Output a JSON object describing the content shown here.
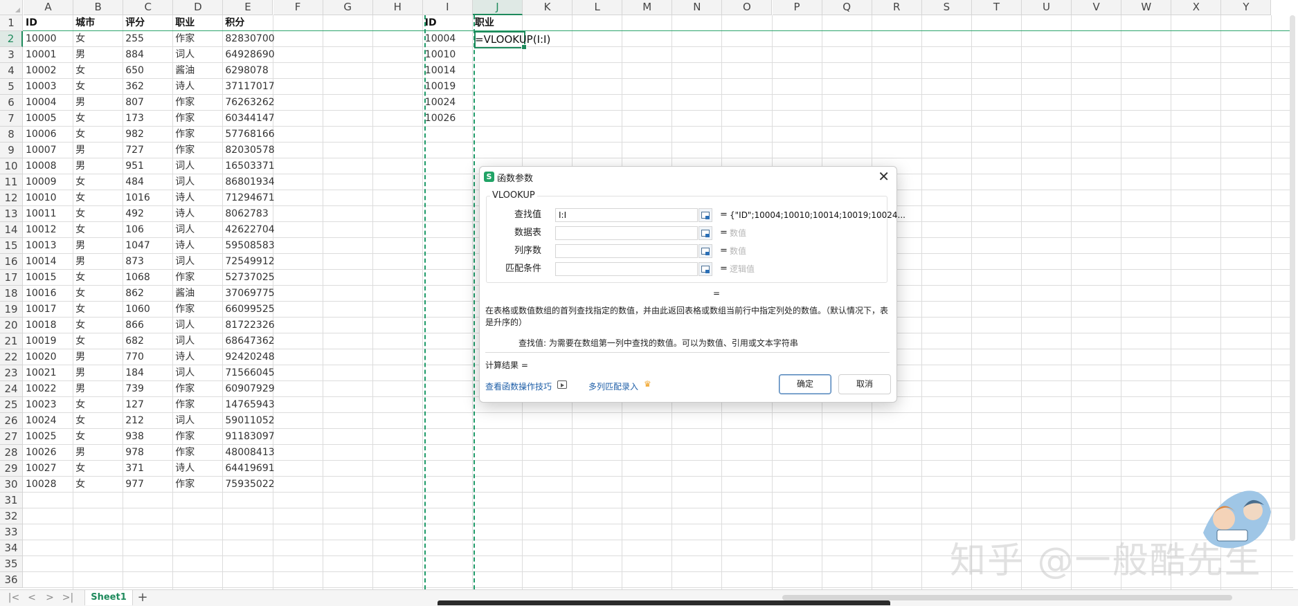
{
  "sheet": {
    "columns": [
      "A",
      "B",
      "C",
      "D",
      "E",
      "F",
      "G",
      "H",
      "I",
      "J",
      "K",
      "L",
      "M",
      "N",
      "O",
      "P",
      "Q",
      "R",
      "S",
      "T",
      "U",
      "V",
      "W",
      "X",
      "Y"
    ],
    "rows": [
      "1",
      "2",
      "3",
      "4",
      "5",
      "6",
      "7",
      "8",
      "9",
      "10",
      "11",
      "12",
      "13",
      "14",
      "15",
      "16",
      "17",
      "18",
      "19",
      "20",
      "21",
      "22",
      "23",
      "24",
      "25",
      "26",
      "27",
      "28",
      "29",
      "30",
      "31",
      "32",
      "33",
      "34",
      "35",
      "36"
    ],
    "active_col": "J",
    "active_row": "2",
    "headers": {
      "A": "ID",
      "B": "城市",
      "C": "评分",
      "D": "职业",
      "E": "积分",
      "I": "ID",
      "J": "职业"
    },
    "table": [
      [
        "10000",
        "女",
        "255",
        "作家",
        "82830700"
      ],
      [
        "10001",
        "男",
        "884",
        "词人",
        "64928690"
      ],
      [
        "10002",
        "女",
        "650",
        "酱油",
        "6298078"
      ],
      [
        "10003",
        "女",
        "362",
        "诗人",
        "37117017"
      ],
      [
        "10004",
        "男",
        "807",
        "作家",
        "76263262"
      ],
      [
        "10005",
        "女",
        "173",
        "作家",
        "60344147"
      ],
      [
        "10006",
        "女",
        "982",
        "作家",
        "57768166"
      ],
      [
        "10007",
        "男",
        "727",
        "作家",
        "82030578"
      ],
      [
        "10008",
        "男",
        "951",
        "词人",
        "16503371"
      ],
      [
        "10009",
        "女",
        "484",
        "词人",
        "86801934"
      ],
      [
        "10010",
        "女",
        "1016",
        "诗人",
        "71294671"
      ],
      [
        "10011",
        "女",
        "492",
        "诗人",
        "8062783"
      ],
      [
        "10012",
        "女",
        "106",
        "词人",
        "42622704"
      ],
      [
        "10013",
        "男",
        "1047",
        "诗人",
        "59508583"
      ],
      [
        "10014",
        "男",
        "873",
        "词人",
        "72549912"
      ],
      [
        "10015",
        "女",
        "1068",
        "作家",
        "52737025"
      ],
      [
        "10016",
        "女",
        "862",
        "酱油",
        "37069775"
      ],
      [
        "10017",
        "女",
        "1060",
        "作家",
        "66099525"
      ],
      [
        "10018",
        "女",
        "866",
        "词人",
        "81722326"
      ],
      [
        "10019",
        "女",
        "682",
        "词人",
        "68647362"
      ],
      [
        "10020",
        "男",
        "770",
        "诗人",
        "92420248"
      ],
      [
        "10021",
        "男",
        "184",
        "词人",
        "71566045"
      ],
      [
        "10022",
        "男",
        "739",
        "作家",
        "60907929"
      ],
      [
        "10023",
        "女",
        "127",
        "作家",
        "14765943"
      ],
      [
        "10024",
        "女",
        "212",
        "词人",
        "59011052"
      ],
      [
        "10025",
        "女",
        "938",
        "作家",
        "91183097"
      ],
      [
        "10026",
        "男",
        "978",
        "作家",
        "48008413"
      ],
      [
        "10027",
        "女",
        "371",
        "诗人",
        "64419691"
      ],
      [
        "10028",
        "女",
        "977",
        "作家",
        "75935022"
      ]
    ],
    "lookup_ids": [
      "10004",
      "10010",
      "10014",
      "10019",
      "10024",
      "10026"
    ],
    "formula": "=VLOOKUP(I:I)"
  },
  "bottombar": {
    "sheet_tab": "Sheet1",
    "nav": [
      "|<",
      "<",
      ">",
      ">|"
    ],
    "add": "+"
  },
  "dialog": {
    "title": "函数参数",
    "title_icon": "S",
    "close": "✕",
    "function_name": "VLOOKUP",
    "args": [
      {
        "label": "查找值",
        "value": "I:I",
        "result": "{\"ID\";10004;10010;10014;10019;10024...",
        "hint": false
      },
      {
        "label": "数据表",
        "value": "",
        "result": "数值",
        "hint": true
      },
      {
        "label": "列序数",
        "value": "",
        "result": "数值",
        "hint": true
      },
      {
        "label": "匹配条件",
        "value": "",
        "result": "逻辑值",
        "hint": true
      }
    ],
    "eq": "=",
    "result_eq": "=",
    "description": "在表格或数值数组的首列查找指定的数值，并由此返回表格或数组当前行中指定列处的数值。（默认情况下，表是升序的）",
    "arg_description": "查找值:  为需要在数组第一列中查找的数值。可以为数值、引用或文本字符串",
    "calc_result": "计算结果  =",
    "tips_link": "查看函数操作技巧",
    "multi_link": "多列匹配录入",
    "ok": "确定",
    "cancel": "取消"
  },
  "watermark": "知乎 @一般酷先生",
  "colors": {
    "accent": "#1e8a5c",
    "link": "#1f5fa8",
    "grid": "#dcdcdc"
  }
}
